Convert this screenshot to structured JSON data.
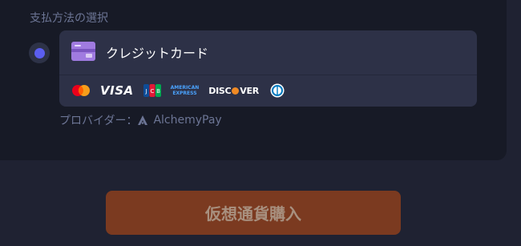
{
  "payment": {
    "section_title": "支払方法の選択",
    "method_label": "クレジットカード",
    "selected": true,
    "card_networks": [
      "mastercard",
      "VISA",
      "JCB",
      "AMERICAN EXPRESS",
      "DISCOVER",
      "Diners Club"
    ],
    "visa_text": "VISA",
    "amex_line1": "AMERICAN",
    "amex_line2": "EXPRESS",
    "discover_pre": "DISC",
    "discover_post": "VER",
    "provider_label": "プロバイダー：",
    "provider_name": "AlchemyPay"
  },
  "actions": {
    "buy_label": "仮想通貨購入"
  },
  "colors": {
    "accent": "#5b5ef0",
    "button": "#7b3a20",
    "card_bg": "#2d3147"
  }
}
